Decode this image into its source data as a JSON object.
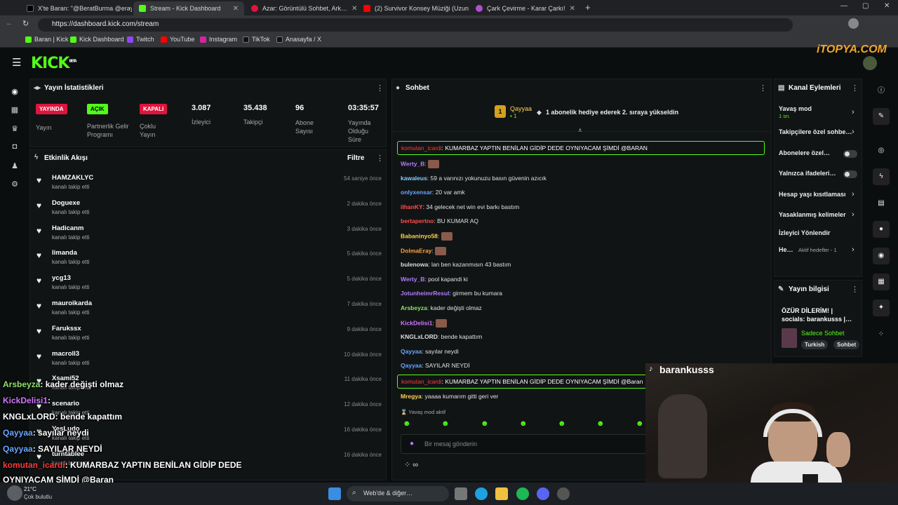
{
  "browser": {
    "tabs": [
      "X'te Baran: \"@BeratBurma @eray…",
      "Stream - Kick Dashboard",
      "Azar: Görüntülü Sohbet, Ark…",
      "(2) Survivor Konsey Müziği (Uzun…",
      "Çark Çevirme - Karar Çarkı!"
    ],
    "url": "https://dashboard.kick.com/stream",
    "bookmarks": [
      "Baran | Kick",
      "Kick Dashboard",
      "Twitch",
      "YouTube",
      "Instagram",
      "TikTok",
      "Anasayfa / X"
    ]
  },
  "brand": {
    "logo": "KICK",
    "beta": "BETA",
    "watermark": "iTOPYA.COM"
  },
  "stats": {
    "title": "Yayın İstatistikleri",
    "badges": [
      {
        "badge": "YAYINDA",
        "label": "Yayın",
        "color": "#e0143c"
      },
      {
        "badge": "AÇIK",
        "label": "Partnerlik Gelir Programı",
        "color": "#53fc18"
      },
      {
        "badge": "KAPALI",
        "label": "Çoklu Yayın",
        "color": "#e0143c"
      }
    ],
    "numbers": [
      {
        "value": "3.087",
        "label": "İzleyici"
      },
      {
        "value": "35.438",
        "label": "Takipçi"
      },
      {
        "value": "96",
        "label": "Abone Sayısı"
      },
      {
        "value": "03:35:57",
        "label": "Yayında Olduğu Süre"
      }
    ]
  },
  "activity": {
    "title": "Etkinlik Akışı",
    "filter": "Filtre",
    "items": [
      {
        "name": "HAMZAKLYC",
        "sub": "kanalı takip etti",
        "time": "54 saniye önce"
      },
      {
        "name": "Doguexe",
        "sub": "kanalı takip etti",
        "time": "2 dakika önce"
      },
      {
        "name": "Hadicanm",
        "sub": "kanalı takip etti",
        "time": "3 dakika önce"
      },
      {
        "name": "limanda",
        "sub": "kanalı takip etti",
        "time": "5 dakika önce"
      },
      {
        "name": "ycg13",
        "sub": "kanalı takip etti",
        "time": "5 dakika önce"
      },
      {
        "name": "mauroikarda",
        "sub": "kanalı takip etti",
        "time": "7 dakika önce"
      },
      {
        "name": "Farukssx",
        "sub": "kanalı takip etti",
        "time": "9 dakika önce"
      },
      {
        "name": "macroll3",
        "sub": "kanalı takip etti",
        "time": "10 dakika önce"
      },
      {
        "name": "Xsami52",
        "sub": "kanalı takip etti",
        "time": "11 dakika önce"
      },
      {
        "name": "scenario",
        "sub": "kanalı takip etti",
        "time": "12 dakika önce"
      },
      {
        "name": "YesLudo",
        "sub": "kanalı takip etti",
        "time": "16 dakika önce"
      },
      {
        "name": "turntablee",
        "sub": "kanalı takip etti",
        "time": "16 dakika önce"
      }
    ]
  },
  "chat": {
    "title": "Sohbet",
    "pinned": {
      "user": "Qayyaa",
      "count": "1",
      "rank": "1",
      "text": "1 abonelik hediye ederek 2. sıraya yükseldin"
    },
    "top_highlight": {
      "user": "komutan_icardi",
      "text": "KUMARBAZ YAPTIN BENİLAN GİDİP DEDE OYNIYACAM ŞİMDİ @BARAN"
    },
    "messages": [
      {
        "user": "Werty_B",
        "color": "#b07cff",
        "text": ""
      },
      {
        "user": "kawaleus",
        "color": "#7fd0ff",
        "text": "59 a varınızı yokunuzu basın güvenin azıcık"
      },
      {
        "user": "onlyxensar",
        "color": "#6aa6ff",
        "text": "20 var amk"
      },
      {
        "user": "ilhanKY",
        "color": "#ff4d4d",
        "text": "34 gelecek net win evi barkı bastım"
      },
      {
        "user": "bertapertno",
        "color": "#ff4d4d",
        "text": "BU KUMAR AQ"
      },
      {
        "user": "Babaninyo58",
        "color": "#ffd24d",
        "text": ""
      },
      {
        "user": "DolmaEray",
        "color": "#ffa23a",
        "text": ""
      },
      {
        "user": "bulenowa",
        "color": "#dddddd",
        "text": "lan ben kazanmısın 43 bastım"
      },
      {
        "user": "Werty_B",
        "color": "#b07cff",
        "text": "pool kapandi ki"
      },
      {
        "user": "JotunheimrResul",
        "color": "#b07cff",
        "text": "girmem bu kumara"
      },
      {
        "user": "Arsbeyza",
        "color": "#8fe36a",
        "text": "kader değişti olmaz"
      },
      {
        "user": "KickDelisi1",
        "color": "#d077ff",
        "text": ""
      },
      {
        "user": "KNGLxLORD",
        "color": "#dddddd",
        "text": "bende kapattım"
      },
      {
        "user": "Qayyaa",
        "color": "#6aa6ff",
        "text": "sayılar neydi"
      },
      {
        "user": "Qayyaa",
        "color": "#6aa6ff",
        "text": "SAYILAR NEYDİ"
      }
    ],
    "bottom_highlight": {
      "user": "komutan_icardi",
      "text": "KUMARBAZ YAPTIN BENİLAN GİDİP DEDE OYNIYACAM ŞİMDİ @Baran"
    },
    "last": {
      "user": "Mregya",
      "text": "yaaaa kumarım gitti geri ver"
    },
    "slow_mode": "Yavaş mod aktif",
    "input_placeholder": "Bir mesaj gönderin"
  },
  "channel_actions": {
    "title": "Kanal Eylemleri",
    "rows": [
      {
        "label": "Yavaş mod",
        "sub": "1 sn.",
        "type": "chevron"
      },
      {
        "label": "Takipçilere özel sohbe…",
        "type": "chevron"
      },
      {
        "label": "Abonelere özel…",
        "type": "toggle"
      },
      {
        "label": "Yalnızca ifadeleri…",
        "type": "toggle"
      },
      {
        "label": "Hesap yaşı kısıtlaması",
        "type": "chevron"
      },
      {
        "label": "Yasaklanmış kelimeler",
        "type": "chevron"
      },
      {
        "label": "İzleyici Yönlendir",
        "type": "none"
      },
      {
        "label": "He…",
        "sub": "Aktif hedefler - 1",
        "type": "chevron"
      }
    ]
  },
  "stream_info": {
    "title": "Yayın bilgisi",
    "stream_title": "ÖZÜR DİLERİM! | socials: barankusss |…",
    "category": "Sadece Sohbet",
    "tags": [
      "Turkish",
      "Sohbet"
    ]
  },
  "overlay": {
    "streamer": "barankusss",
    "lines": [
      {
        "user": "Arsbeyza",
        "color": "#8fe36a",
        "text": ": kader değişti olmaz"
      },
      {
        "user": "KickDelisi1",
        "color": "#d077ff",
        "text": ":"
      },
      {
        "user": "KNGLxLORD",
        "color": "#ffffff",
        "text": ": bende kapattım"
      },
      {
        "user": "Qayyaa",
        "color": "#6aa6ff",
        "text": ": sayılar neydi"
      },
      {
        "user": "Qayyaa",
        "color": "#6aa6ff",
        "text": ": SAYILAR NEYDİ"
      },
      {
        "user": "komutan_icardi",
        "color": "#ff3b3b",
        "text": ": KUMARBAZ YAPTIN BENİLAN GİDİP DEDE"
      },
      {
        "user": "",
        "color": "#ffffff",
        "text": "OYNIYACAM ŞİMDİ @Baran"
      }
    ]
  },
  "taskbar": {
    "weather_temp": "21°C",
    "weather_desc": "Çok bulutlu",
    "search": "Web'de & diğer…"
  }
}
